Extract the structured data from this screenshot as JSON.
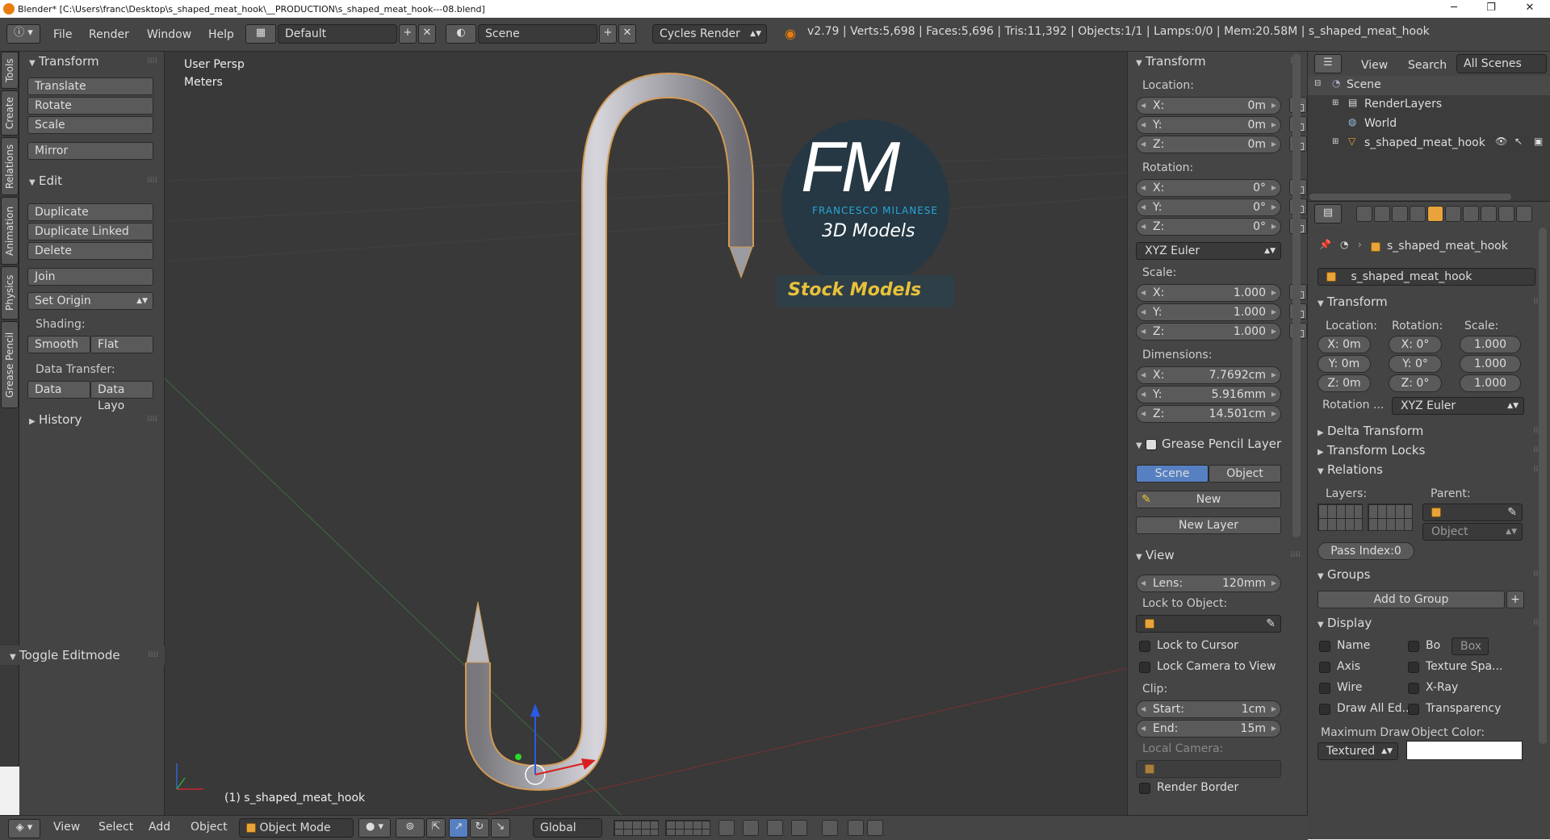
{
  "window": {
    "title": "Blender* [C:\\Users\\franc\\Desktop\\s_shaped_meat_hook\\__PRODUCTION\\s_shaped_meat_hook---08.blend]"
  },
  "header": {
    "menus": [
      "File",
      "Render",
      "Window",
      "Help"
    ],
    "layout": "Default",
    "scene": "Scene",
    "engine": "Cycles Render",
    "stats": "v2.79 | Verts:5,698 | Faces:5,696 | Tris:11,392 | Objects:1/1 | Lamps:0/0 | Mem:20.58M | s_shaped_meat_hook"
  },
  "tool_tabs": [
    "Tools",
    "Create",
    "Relations",
    "Animation",
    "Physics",
    "Grease Pencil"
  ],
  "tool_shelf": {
    "transform_title": "Transform",
    "translate": "Translate",
    "rotate": "Rotate",
    "scale": "Scale",
    "mirror": "Mirror",
    "edit_title": "Edit",
    "duplicate": "Duplicate",
    "duplicate_linked": "Duplicate Linked",
    "delete": "Delete",
    "join": "Join",
    "set_origin": "Set Origin",
    "shading_label": "Shading:",
    "smooth": "Smooth",
    "flat": "Flat",
    "data_transfer_label": "Data Transfer:",
    "data": "Data",
    "data_layo": "Data Layo",
    "history": "History",
    "toggle_editmode": "Toggle Editmode"
  },
  "viewport": {
    "view_label": "User Persp",
    "units": "Meters",
    "object_label": "(1) s_shaped_meat_hook",
    "watermark": {
      "initials": "FM",
      "name": "FRANCESCO MILANESE",
      "subtitle": "3D Models",
      "tagline": "Stock Models"
    }
  },
  "n_panel": {
    "transform_title": "Transform",
    "location_label": "Location:",
    "location": [
      {
        "k": "X:",
        "v": "0m"
      },
      {
        "k": "Y:",
        "v": "0m"
      },
      {
        "k": "Z:",
        "v": "0m"
      }
    ],
    "rotation_label": "Rotation:",
    "rotation": [
      {
        "k": "X:",
        "v": "0°"
      },
      {
        "k": "Y:",
        "v": "0°"
      },
      {
        "k": "Z:",
        "v": "0°"
      }
    ],
    "rotation_mode": "XYZ Euler",
    "scale_label": "Scale:",
    "scale": [
      {
        "k": "X:",
        "v": "1.000"
      },
      {
        "k": "Y:",
        "v": "1.000"
      },
      {
        "k": "Z:",
        "v": "1.000"
      }
    ],
    "dimensions_label": "Dimensions:",
    "dimensions": [
      {
        "k": "X:",
        "v": "7.7692cm"
      },
      {
        "k": "Y:",
        "v": "5.916mm"
      },
      {
        "k": "Z:",
        "v": "14.501cm"
      }
    ],
    "grease_title": "Grease Pencil Layer",
    "gp_scene": "Scene",
    "gp_object": "Object",
    "gp_new": "New",
    "gp_new_layer": "New Layer",
    "view_title": "View",
    "lens_label": "Lens:",
    "lens_value": "120mm",
    "lock_to_object_label": "Lock to Object:",
    "lock_to_cursor": "Lock to Cursor",
    "lock_camera": "Lock Camera to View",
    "clip_label": "Clip:",
    "clip_start_label": "Start:",
    "clip_start": "1cm",
    "clip_end_label": "End:",
    "clip_end": "15m",
    "local_camera_label": "Local Camera:",
    "render_border": "Render Border"
  },
  "outliner": {
    "view": "View",
    "search": "Search",
    "all_scenes": "All Scenes",
    "items": [
      "Scene",
      "RenderLayers",
      "World",
      "s_shaped_meat_hook"
    ]
  },
  "properties": {
    "object_name": "s_shaped_meat_hook",
    "name_field": "s_shaped_meat_hook",
    "transform_title": "Transform",
    "location_label": "Location:",
    "rotation_label": "Rotation:",
    "scale_label": "Scale:",
    "loc": [
      "X: 0m",
      "Y: 0m",
      "Z: 0m"
    ],
    "rot": [
      "X:",
      "Y:",
      "Z:"
    ],
    "rot_v": [
      "0°",
      "0°",
      "0°"
    ],
    "scl": [
      "1.000",
      "1.000",
      "1.000"
    ],
    "rotation_mode_label": "Rotation ...",
    "rotation_mode": "XYZ Euler",
    "delta_transform": "Delta Transform",
    "transform_locks": "Transform Locks",
    "relations": "Relations",
    "layers_label": "Layers:",
    "parent_label": "Parent:",
    "parent_type": "Object",
    "pass_index": "Pass Index:0",
    "groups": "Groups",
    "add_to_group": "Add to Group",
    "display": "Display",
    "disp_name": "Name",
    "disp_bo": "Bo",
    "disp_box": "Box",
    "disp_axis": "Axis",
    "disp_texture": "Texture Spa...",
    "disp_wire": "Wire",
    "disp_xray": "X-Ray",
    "disp_drawall": "Draw All Ed...",
    "disp_transp": "Transparency",
    "max_draw_label": "Maximum Draw",
    "object_color_label": "Object Color:",
    "max_draw_value": "Textured"
  },
  "bottom_bar": {
    "menus": [
      "View",
      "Select",
      "Add",
      "Object"
    ],
    "mode": "Object Mode",
    "orientation": "Global"
  }
}
